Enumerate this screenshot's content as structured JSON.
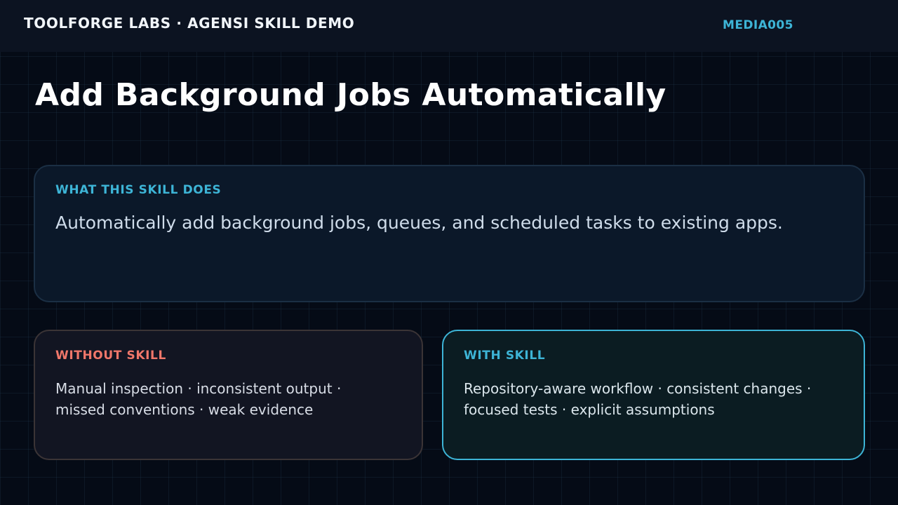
{
  "header": {
    "brand": "TOOLFORGE LABS · AGENSI SKILL DEMO",
    "media_id": "MEDIA005"
  },
  "title": "Add Background Jobs Automatically",
  "what_card": {
    "label": "WHAT THIS SKILL DOES",
    "text": "Automatically add background jobs, queues, and scheduled tasks to existing apps."
  },
  "without_card": {
    "label": "WITHOUT SKILL",
    "lines": [
      "Manual inspection · inconsistent output ·",
      "missed conventions · weak evidence"
    ]
  },
  "with_card": {
    "label": "WITH SKILL",
    "lines": [
      "Repository-aware workflow · consistent changes ·",
      "focused tests · explicit assumptions"
    ]
  },
  "colors": {
    "accent": "#3db4d6",
    "warning": "#f0776a",
    "background": "#050b16"
  }
}
